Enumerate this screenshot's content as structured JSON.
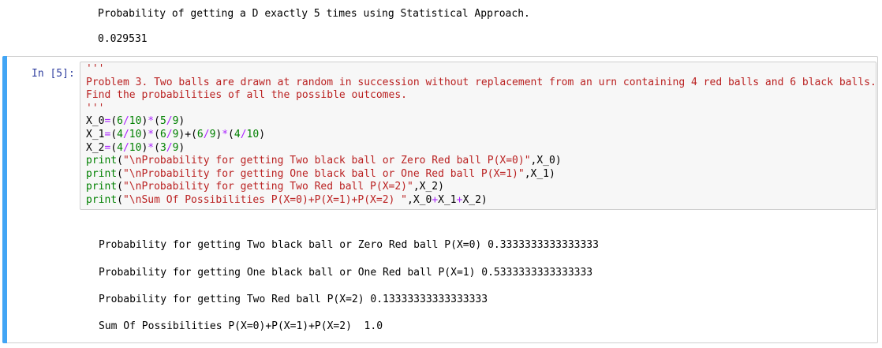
{
  "previous_output": {
    "line1": "Probability of getting a D exactly 5 times using Statistical Approach.",
    "line2": "0.029531"
  },
  "cell": {
    "prompt": "In [5]:",
    "code": {
      "doc_open": "'''",
      "doc_line1": "Problem 3. Two balls are drawn at random in succession without replacement from an urn containing 4 red balls and 6 black balls.",
      "doc_line2": "Find the probabilities of all the possible outcomes.",
      "doc_close": "'''",
      "x0": {
        "var": "X_0",
        "eq": "=",
        "p1": "(",
        "a": "6",
        "div1": "/",
        "b": "10",
        "p2": ")",
        "mul": "*",
        "p3": "(",
        "c": "5",
        "div2": "/",
        "d": "9",
        "p4": ")"
      },
      "x1": {
        "var": "X_1",
        "eq": "=",
        "p1": "(",
        "a": "4",
        "div1": "/",
        "b": "10",
        "p2": ")",
        "mul1": "*",
        "p3": "(",
        "c": "6",
        "div2": "/",
        "d": "9",
        "p4": ")+",
        "plus": "",
        "p5": "(",
        "e": "6",
        "div3": "/",
        "f": "9",
        "p6": ")",
        "mul2": "*",
        "p7": "(",
        "g": "4",
        "div4": "/",
        "h": "10",
        "p8": ")"
      },
      "x2": {
        "var": "X_2",
        "eq": "=",
        "p1": "(",
        "a": "4",
        "div1": "/",
        "b": "10",
        "p2": ")",
        "mul": "*",
        "p3": "(",
        "c": "3",
        "div2": "/",
        "d": "9",
        "p4": ")"
      },
      "print1": {
        "fn": "print",
        "open": "(",
        "str": "\"\\nProbability for getting Two black ball or Zero Red ball P(X=0)\"",
        "rest": ",X_0)"
      },
      "print2": {
        "fn": "print",
        "open": "(",
        "str": "\"\\nProbability for getting One black ball or One Red ball P(X=1)\"",
        "rest": ",X_1)"
      },
      "print3": {
        "fn": "print",
        "open": "(",
        "str": "\"\\nProbability for getting Two Red ball P(X=2)\"",
        "rest": ",X_2)"
      },
      "print4": {
        "fn": "print",
        "open": "(",
        "str": "\"\\nSum Of Possibilities P(X=0)+P(X=1)+P(X=2) \"",
        "rest1": ",X_0",
        "plus1": "+",
        "mid": "X_1",
        "plus2": "+",
        "rest2": "X_2)"
      }
    },
    "outputs": [
      "Probability for getting Two black ball or Zero Red ball P(X=0) 0.3333333333333333",
      "Probability for getting One black ball or One Red ball P(X=1) 0.5333333333333333",
      "Probability for getting Two Red ball P(X=2) 0.13333333333333333",
      "Sum Of Possibilities P(X=0)+P(X=1)+P(X=2)  1.0"
    ]
  }
}
